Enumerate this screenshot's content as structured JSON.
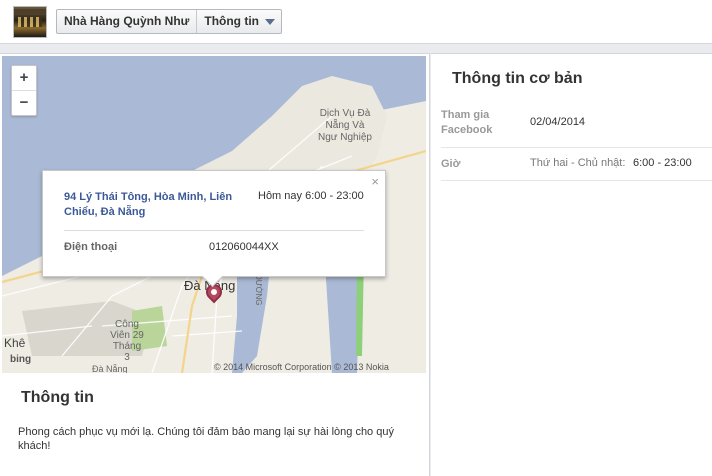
{
  "header": {
    "page_name": "Nhà Hàng Quỳnh Như",
    "section_label": "Thông tin"
  },
  "map": {
    "zoom_in": "+",
    "zoom_out": "−",
    "labels": {
      "district_label": "Dịch Vụ Đà Nẵng Và Ngư Nghiệp",
      "city": "Đà Nẵng",
      "park": "Công Viên 29 Tháng 3",
      "khe": "Khê",
      "da_nang_bottom": "Đà Nẵng",
      "road": "ĐƯỜNG"
    },
    "bing": "bing",
    "copyright": "© 2014 Microsoft Corporation  © 2013 Nokia"
  },
  "popup": {
    "address": "94 Lý Thái Tông, Hòa Minh, Liên Chiểu, Đà Nẵng",
    "hours": "Hôm nay 6:00 - 23:00",
    "phone_label": "Điện thoại",
    "phone": "012060044XX",
    "close": "×"
  },
  "about": {
    "title": "Thông tin",
    "text": "Phong cách phục vụ mới lạ. Chúng tôi đảm bảo mang lại sự hài lòng cho quý khách!"
  },
  "basic_info": {
    "title": "Thông tin cơ bản",
    "rows": [
      {
        "label": "Tham gia Facebook",
        "value": "02/04/2014"
      },
      {
        "label": "Giờ",
        "days": "Thứ hai - Chủ nhật:",
        "value": "6:00 - 23:00"
      }
    ]
  }
}
